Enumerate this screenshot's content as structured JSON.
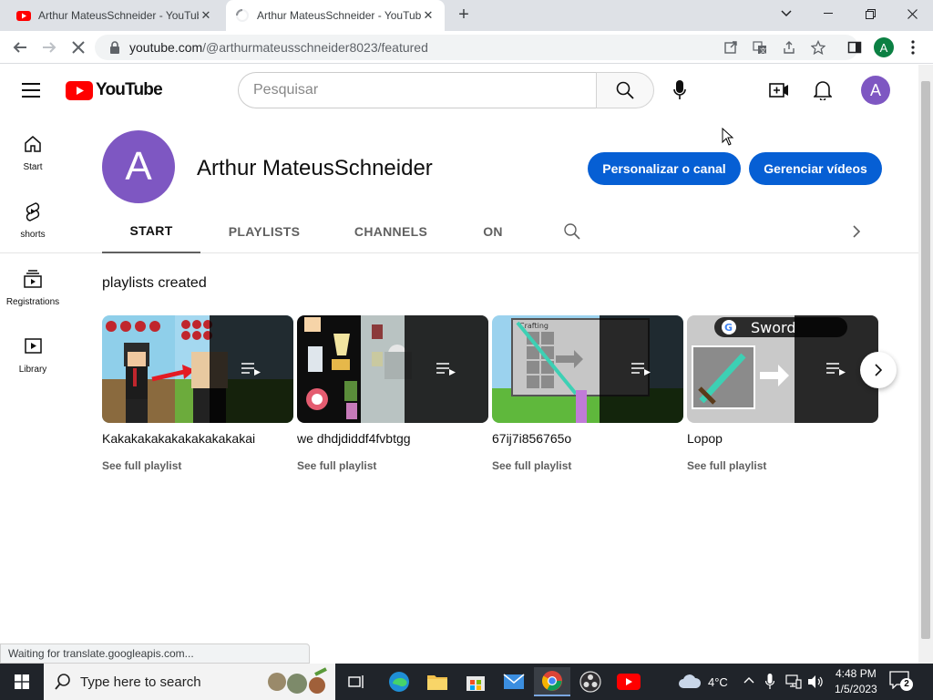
{
  "browser": {
    "tabs": [
      {
        "title": "Arthur MateusSchneider - YouTube",
        "active": false
      },
      {
        "title": "Arthur MateusSchneider - YouTube",
        "active": true
      }
    ],
    "url_host": "youtube.com",
    "url_path": "/@arthurmateusschneider8023/featured",
    "profile_initial": "A"
  },
  "youtube": {
    "logo_text": "YouTube",
    "search_placeholder": "Pesquisar",
    "avatar_initial": "A"
  },
  "sidebar": {
    "items": [
      {
        "label": "Start",
        "icon": "home-icon"
      },
      {
        "label": "shorts",
        "icon": "shorts-icon"
      },
      {
        "label": "Registrations",
        "icon": "subscriptions-icon"
      },
      {
        "label": "Library",
        "icon": "library-icon"
      }
    ]
  },
  "channel": {
    "avatar_initial": "A",
    "name": "Arthur MateusSchneider",
    "customize_label": "Personalizar o canal",
    "manage_label": "Gerenciar vídeos",
    "tabs": [
      "START",
      "PLAYLISTS",
      "CHANNELS",
      "ON"
    ]
  },
  "section": {
    "title": "playlists created",
    "cards": [
      {
        "title": "Kakakakakakakakakakakai",
        "link": "See full playlist"
      },
      {
        "title": "we dhdjdiddf4fvbtgg",
        "link": "See full playlist"
      },
      {
        "title": "67ij7i856765o",
        "link": "See full playlist"
      },
      {
        "title": "Lopop",
        "link": "See full playlist"
      }
    ],
    "thumb3_label": "Crafting",
    "thumb4_label": "Sword"
  },
  "status_text": "Waiting for translate.googleapis.com...",
  "taskbar": {
    "search_placeholder": "Type here to search",
    "temperature": "4°C",
    "time": "4:48 PM",
    "date": "1/5/2023",
    "notification_count": "2"
  },
  "colors": {
    "accent_blue": "#065fd4",
    "youtube_red": "#ff0000",
    "avatar_purple": "#7e57c2"
  }
}
